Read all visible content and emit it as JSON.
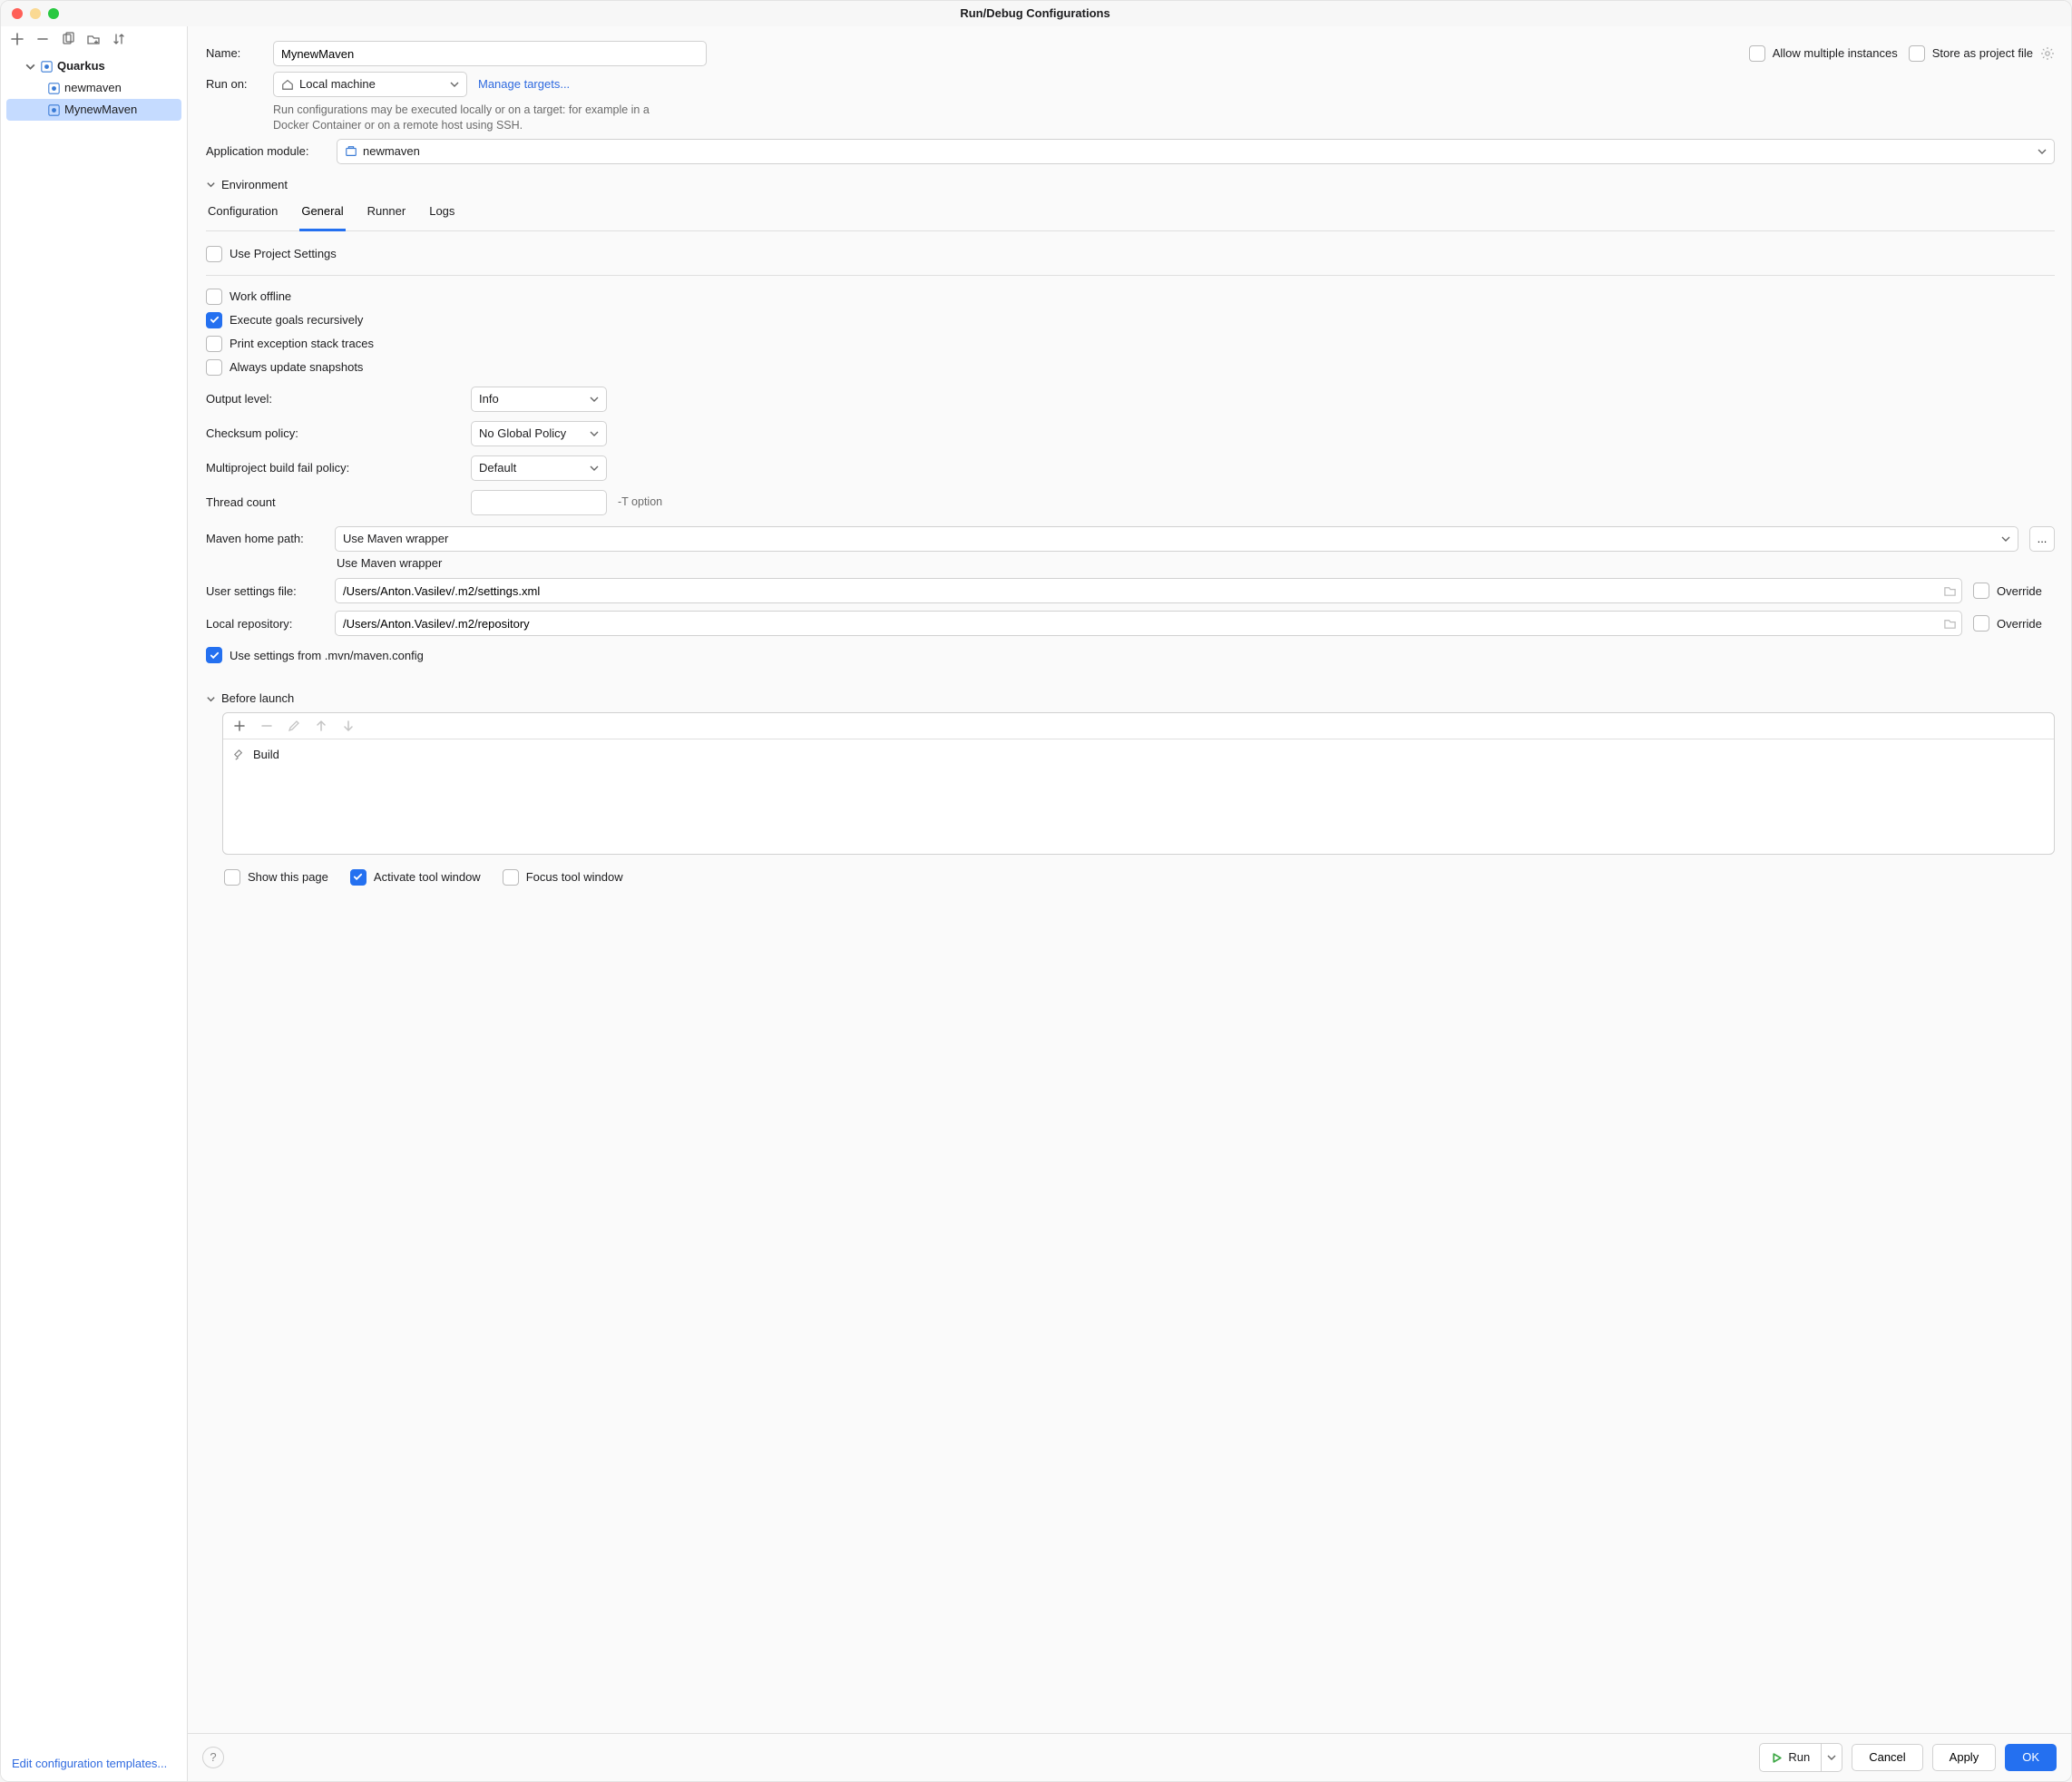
{
  "window": {
    "title": "Run/Debug Configurations"
  },
  "sidebar": {
    "root": "Quarkus",
    "items": [
      "newmaven",
      "MynewMaven"
    ],
    "selected_index": 1,
    "footer_link": "Edit configuration templates..."
  },
  "header": {
    "name_label": "Name:",
    "name_value": "MynewMaven",
    "allow_multiple_label": "Allow multiple instances",
    "allow_multiple_checked": false,
    "store_label": "Store as project file",
    "store_checked": false
  },
  "run_on": {
    "label": "Run on:",
    "value": "Local machine",
    "manage_link": "Manage targets...",
    "hint": "Run configurations may be executed locally or on a target: for example in a Docker Container or on a remote host using SSH."
  },
  "app_module": {
    "label": "Application module:",
    "value": "newmaven"
  },
  "env_section": {
    "title": "Environment"
  },
  "tabs": {
    "items": [
      "Configuration",
      "General",
      "Runner",
      "Logs"
    ],
    "active_index": 1
  },
  "general": {
    "use_project_settings": {
      "label": "Use Project Settings",
      "checked": false
    },
    "work_offline": {
      "label": "Work offline",
      "checked": false
    },
    "execute_recursively": {
      "label": "Execute goals recursively",
      "checked": true
    },
    "print_stack": {
      "label": "Print exception stack traces",
      "checked": false
    },
    "update_snapshots": {
      "label": "Always update snapshots",
      "checked": false
    },
    "output_level": {
      "label": "Output level:",
      "value": "Info"
    },
    "checksum": {
      "label": "Checksum policy:",
      "value": "No Global Policy"
    },
    "fail_policy": {
      "label": "Multiproject build fail policy:",
      "value": "Default"
    },
    "thread_count": {
      "label": "Thread count",
      "value": "",
      "hint": "-T option"
    },
    "maven_home": {
      "label": "Maven home path:",
      "value": "Use Maven wrapper",
      "hint": "Use Maven wrapper",
      "browse": "..."
    },
    "user_settings": {
      "label": "User settings file:",
      "value": "/Users/Anton.Vasilev/.m2/settings.xml",
      "override_label": "Override",
      "override_checked": false
    },
    "local_repo": {
      "label": "Local repository:",
      "value": "/Users/Anton.Vasilev/.m2/repository",
      "override_label": "Override",
      "override_checked": false
    },
    "use_mvn_config": {
      "label": "Use settings from .mvn/maven.config",
      "checked": true
    }
  },
  "before_launch": {
    "title": "Before launch",
    "items": [
      "Build"
    ],
    "show_page": {
      "label": "Show this page",
      "checked": false
    },
    "activate_tool": {
      "label": "Activate tool window",
      "checked": true
    },
    "focus_tool": {
      "label": "Focus tool window",
      "checked": false
    }
  },
  "footer": {
    "run": "Run",
    "cancel": "Cancel",
    "apply": "Apply",
    "ok": "OK"
  }
}
